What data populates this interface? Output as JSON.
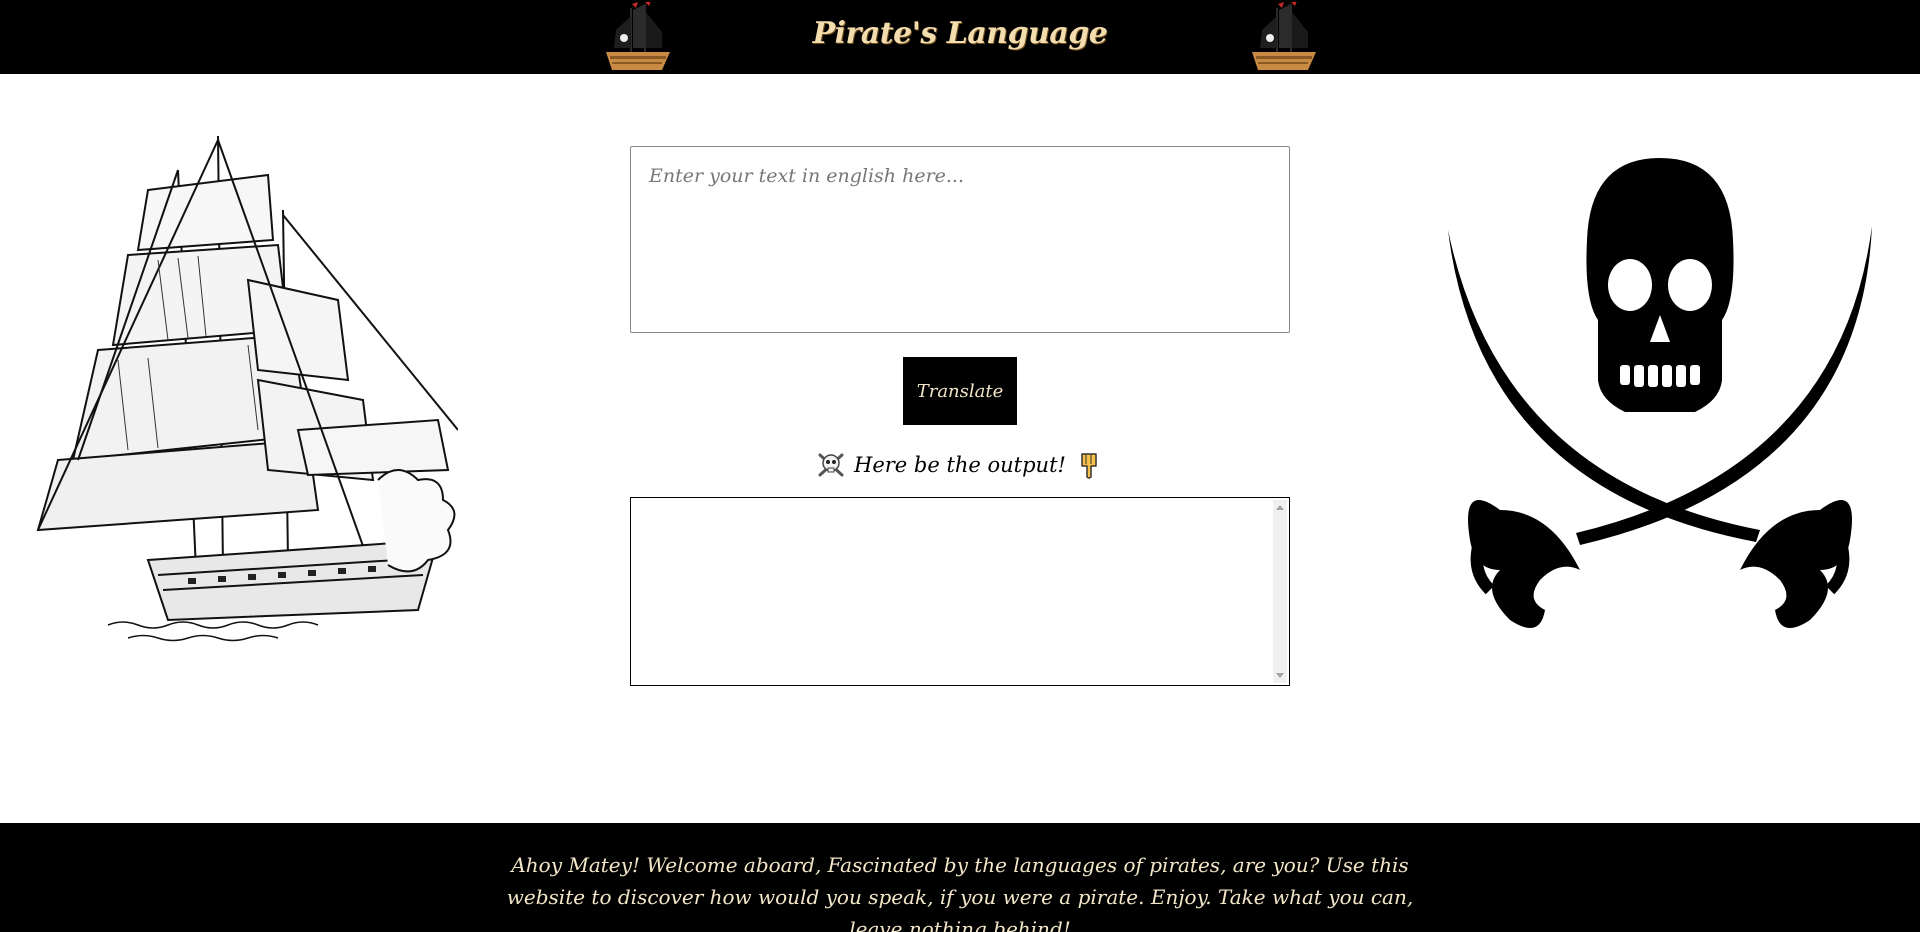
{
  "header": {
    "title": "Pirate's Language",
    "left_icon": "pirate-ship-icon",
    "right_icon": "pirate-ship-icon"
  },
  "translator": {
    "input_placeholder": "Enter your text in english here...",
    "input_value": "",
    "button_label": "Translate",
    "output_label": "Here be the output!",
    "output_label_left_icon": "skull-crossbones-icon",
    "output_label_right_icon": "pointing-down-hand-icon",
    "output_value": ""
  },
  "art": {
    "left": "ship-sketch-icon",
    "right": "jolly-roger-icon"
  },
  "footer": {
    "text": "Ahoy Matey! Welcome aboard, Fascinated by the languages of pirates, are you? Use this website to discover how would you speak, if you were a pirate. Enjoy. Take what you can, leave nothing behind!"
  },
  "colors": {
    "header_bg": "#000000",
    "title_color": "#f3dcae",
    "footer_text": "#f3e6c8",
    "button_bg": "#000000"
  }
}
